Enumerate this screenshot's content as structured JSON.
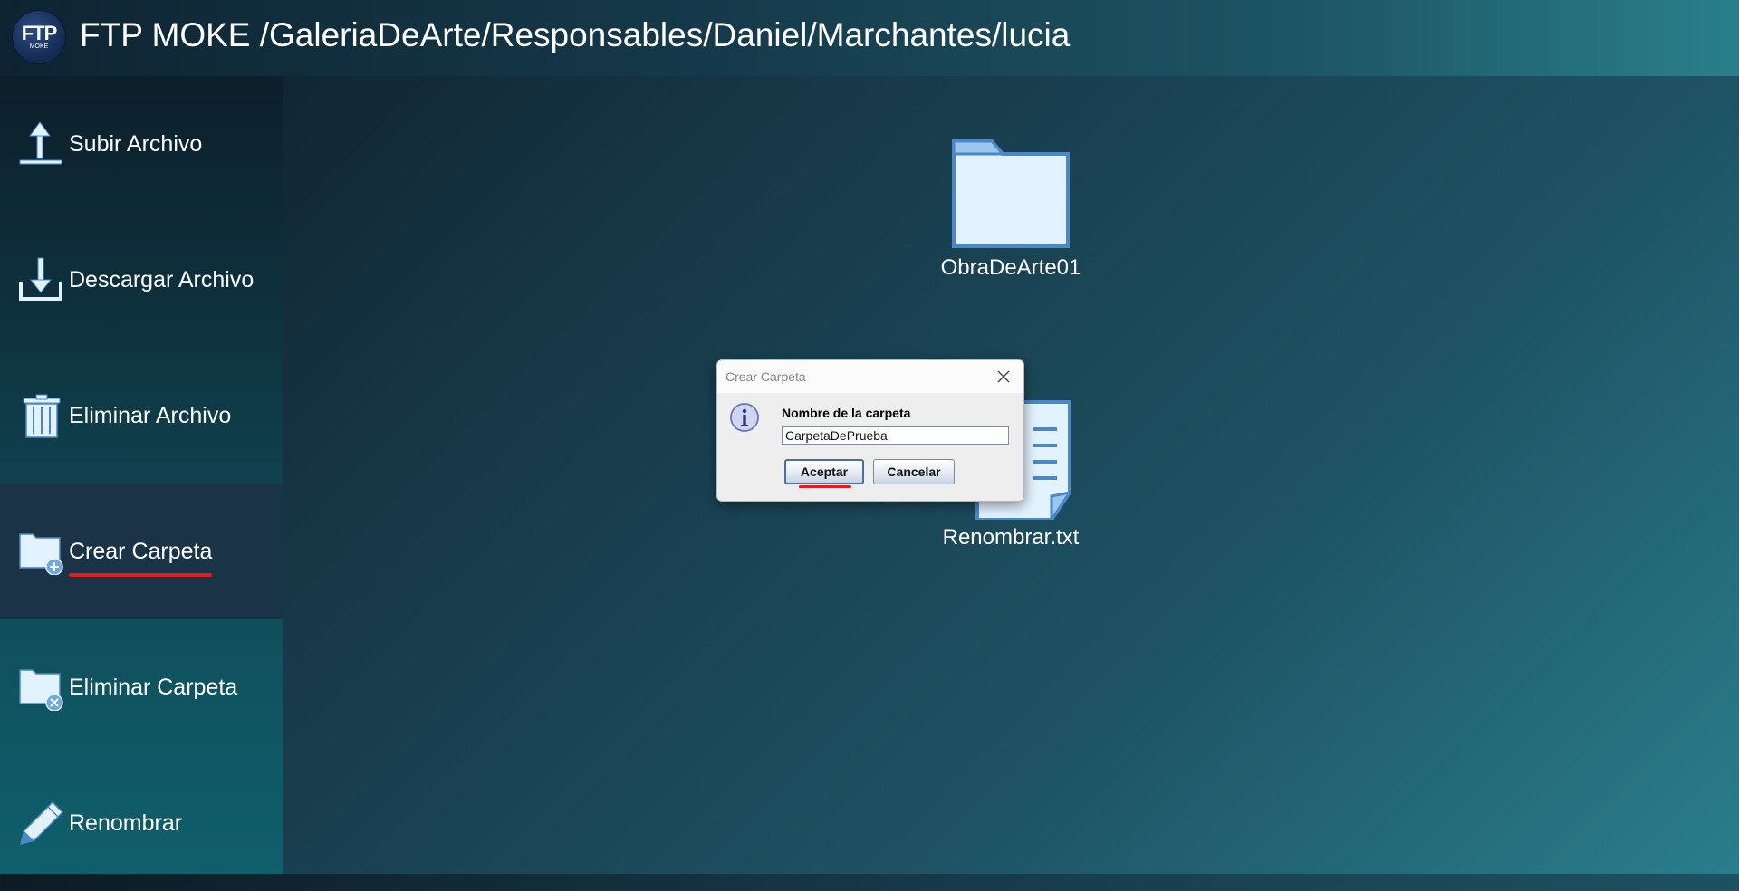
{
  "header": {
    "logo_text": "FTP",
    "logo_subtext": "MOKE",
    "title": "FTP MOKE /GaleriaDeArte/Responsables/Daniel/Marchantes/lucia"
  },
  "sidebar": {
    "items": [
      {
        "label": "Subir Archivo",
        "icon": "upload-icon"
      },
      {
        "label": "Descargar Archivo",
        "icon": "download-icon"
      },
      {
        "label": "Eliminar Archivo",
        "icon": "trash-icon"
      },
      {
        "label": "Crear Carpeta",
        "icon": "folder-add-icon",
        "active": true
      },
      {
        "label": "Eliminar Carpeta",
        "icon": "folder-delete-icon"
      },
      {
        "label": "Renombrar",
        "icon": "pencil-icon"
      }
    ]
  },
  "files": [
    {
      "name": "ObraDeArte01",
      "icon": "folder-icon"
    },
    {
      "name": "Renombrar.txt",
      "icon": "text-file-icon"
    }
  ],
  "dialog": {
    "title": "Crear Carpeta",
    "label": "Nombre de la carpeta",
    "input_value": "CarpetaDePrueba",
    "accept_label": "Aceptar",
    "cancel_label": "Cancelar",
    "icon": "info-icon"
  },
  "colors": {
    "annotation_underline": "#e01e1e",
    "icon_fill": "#e3f2ff",
    "icon_stroke": "#4a88c7"
  }
}
